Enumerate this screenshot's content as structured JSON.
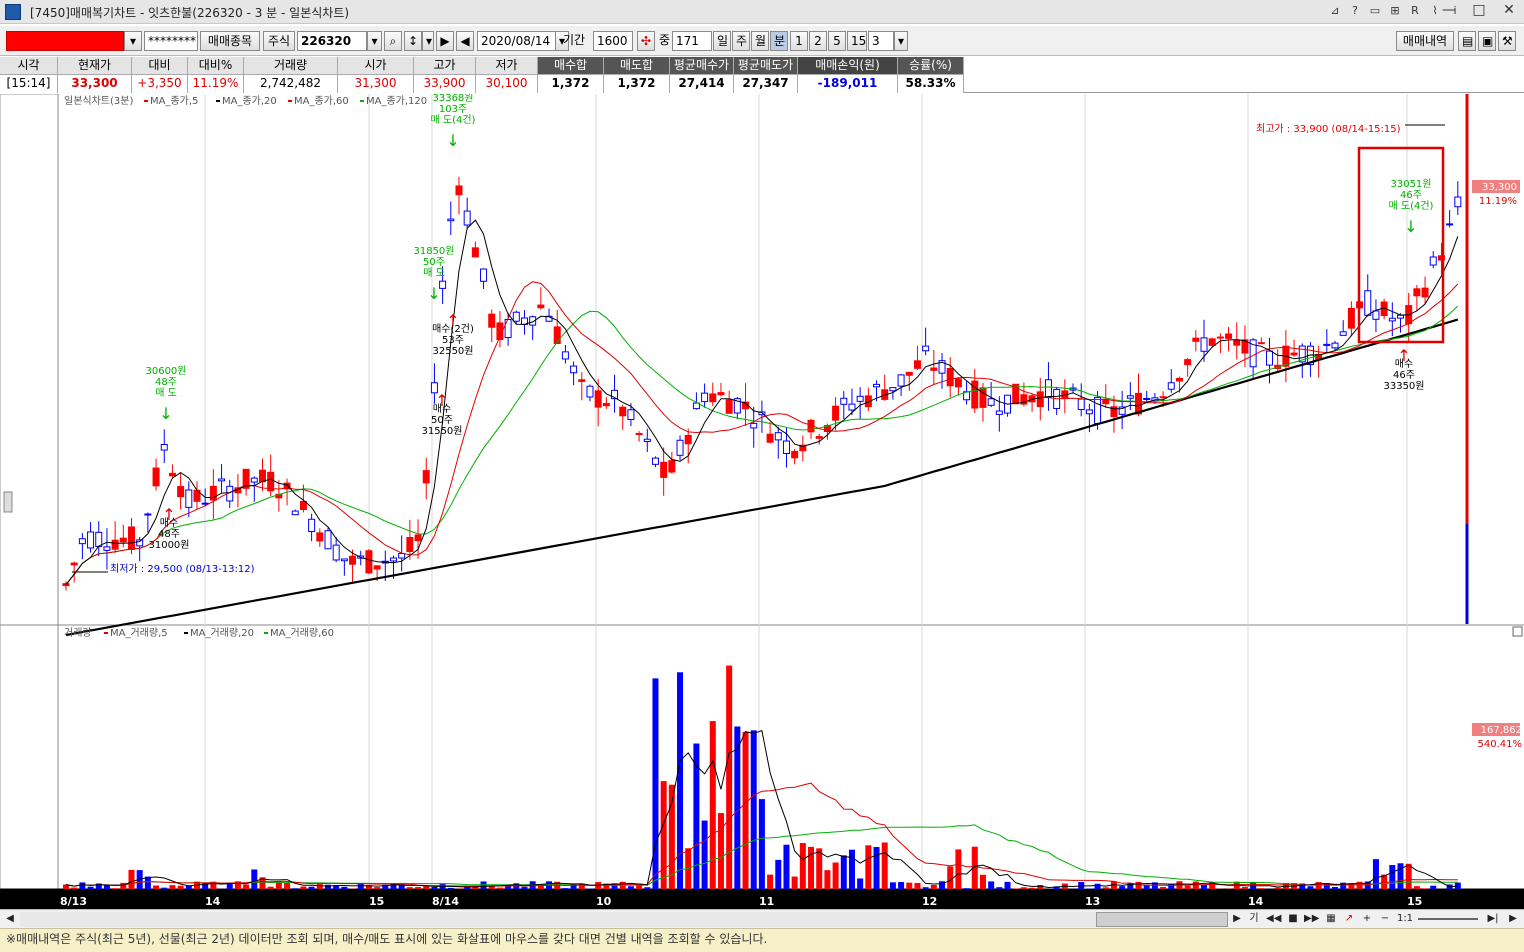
{
  "window": {
    "title": "[7450]매매복기차트 - 잇츠한불(226320 - 3 분 - 일본식차트)",
    "icons": [
      "pin-icon",
      "help-icon",
      "layout-icon",
      "link-icon",
      "r-icon",
      "pen-icon",
      "info-icon"
    ],
    "controls": [
      "minimize",
      "maximize",
      "close"
    ]
  },
  "toolbar": {
    "account_mask": "********",
    "trade_items_button": "매매종목",
    "market_label": "주식",
    "stock_code": "226320",
    "date": "2020/08/14",
    "period_label": "기간",
    "period_value": "1600",
    "count_label": "중",
    "count_value": "171",
    "intervals": [
      "일",
      "주",
      "월",
      "분",
      "1",
      "2",
      "5",
      "15"
    ],
    "selected_interval": "분",
    "minute_value": "3",
    "trade_history_button": "매매내역"
  },
  "quote": {
    "headers": [
      "시각",
      "현재가",
      "대비",
      "대비%",
      "거래량",
      "시가",
      "고가",
      "저가",
      "매수합",
      "매도합",
      "평균매수가",
      "평균매도가",
      "매매손익(원)",
      "승률(%)"
    ],
    "values": [
      "[15:14]",
      "33,300",
      "+3,350",
      "11.19%",
      "2,742,482",
      "31,300",
      "33,900",
      "30,100",
      "1,372",
      "1,372",
      "27,414",
      "27,347",
      "-189,011",
      "58.33%"
    ]
  },
  "chart": {
    "price_legend": "일본식차트(3분)",
    "price_ma": [
      "MA_종가,5",
      "MA_종가,20",
      "MA_종가,60",
      "MA_종가,120"
    ],
    "volume_legend": "거래량",
    "volume_ma": [
      "MA_거래량,5",
      "MA_거래량,20",
      "MA_거래량,60"
    ],
    "high_annot": "최고가 : 33,900 (08/14-15:15)",
    "low_annot": "최저가 : 29,500 (08/13-13:12)",
    "price_tag": "33,300",
    "price_pct": "11.19%",
    "vol_tag": "167,862",
    "vol_pct": "540.41%",
    "x_labels": [
      "8/13",
      "14",
      "15",
      "8/14",
      "10",
      "11",
      "12",
      "13",
      "14",
      "15"
    ],
    "trade_labels": [
      {
        "lines": [
          "30600원",
          "48주",
          "매 도"
        ],
        "color": "green"
      },
      {
        "lines": [
          "매수",
          "48주",
          "31000원"
        ],
        "color": "black"
      },
      {
        "lines": [
          "33368원",
          "103주",
          "매 도(4건)"
        ],
        "color": "green"
      },
      {
        "lines": [
          "31850원",
          "50주",
          "매 도"
        ],
        "color": "green"
      },
      {
        "lines": [
          "매수(2건)",
          "53주",
          "32550원"
        ],
        "color": "black"
      },
      {
        "lines": [
          "매수",
          "50주",
          "31550원"
        ],
        "color": "black"
      },
      {
        "lines": [
          "33051원",
          "46주",
          "매 도(4건)"
        ],
        "color": "green"
      },
      {
        "lines": [
          "매수",
          "46주",
          "33350원"
        ],
        "color": "black"
      }
    ]
  },
  "chart_data": {
    "type": "candlestick",
    "price_ylim": [
      29300,
      34100
    ],
    "ma_colors": {
      "ma5": "#000000",
      "ma20": "#e00000",
      "ma60": "#00b000",
      "ma120": "#000000"
    },
    "up_color": "#ff0000",
    "down_color": "#0000ff"
  },
  "statusbar": {
    "text": "※매매내역은 주식(최근 5년), 선물(최근 2년) 데이터만 조회 되며, 매수/매도 표시에 있는 화살표에 마우스를 갖다 대면 건별 내역을 조회할 수 있습니다."
  }
}
